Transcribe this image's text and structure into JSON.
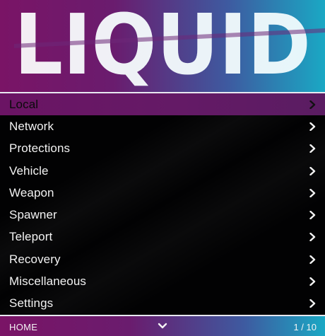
{
  "header": {
    "logo_text": "LIQUID"
  },
  "menu": {
    "items": [
      {
        "label": "Local",
        "selected": true
      },
      {
        "label": "Network"
      },
      {
        "label": "Protections"
      },
      {
        "label": "Vehicle"
      },
      {
        "label": "Weapon"
      },
      {
        "label": "Spawner"
      },
      {
        "label": "Teleport"
      },
      {
        "label": "Recovery"
      },
      {
        "label": "Miscellaneous"
      },
      {
        "label": "Settings"
      }
    ]
  },
  "footer": {
    "section": "HOME",
    "page_indicator": "1 / 10"
  },
  "colors": {
    "accent_magenta": "#7a1466",
    "accent_cyan": "#1aa8c4",
    "background": "#020203",
    "text": "#f2f2f2"
  },
  "icons": {
    "item_arrow": "chevron-right-icon",
    "footer_arrow": "chevron-down-icon"
  }
}
